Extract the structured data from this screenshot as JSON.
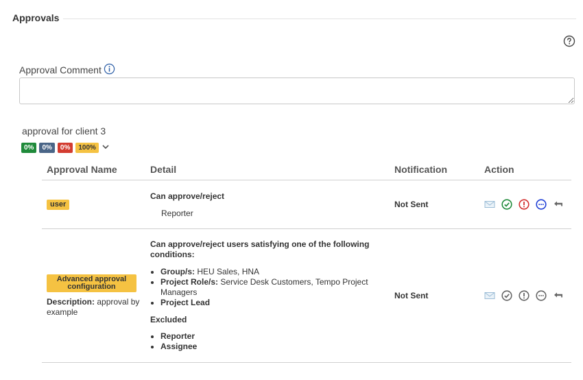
{
  "section": {
    "title": "Approvals"
  },
  "help": {
    "icon": "help-circle-icon"
  },
  "comment": {
    "label": "Approval Comment",
    "value": "",
    "placeholder": "",
    "info_icon": "info-icon"
  },
  "approval": {
    "title": "approval for client 3",
    "badges": [
      {
        "label": "0%",
        "color": "#1f8a3a"
      },
      {
        "label": "0%",
        "color": "#4a6587"
      },
      {
        "label": "0%",
        "color": "#d33c30"
      },
      {
        "label": "100%",
        "color": "#f5c242"
      }
    ],
    "expand_icon": "chevron-down-icon"
  },
  "table": {
    "headers": {
      "name": "Approval Name",
      "detail": "Detail",
      "notification": "Notification",
      "action": "Action"
    },
    "rows": [
      {
        "name": "user",
        "detail_title": "Can approve/reject",
        "detail_sub": "Reporter",
        "notification": "Not Sent",
        "actions": [
          "envelope-icon",
          "approve-check-icon",
          "reject-exclamation-icon",
          "more-options-icon",
          "return-arrow-icon"
        ]
      },
      {
        "name": "Advanced approval configuration",
        "description_label": "Description:",
        "description_value": " approval by example",
        "detail_title": "Can approve/reject users satisfying one of the following conditions:",
        "conditions": {
          "groups_label": "Group/s:",
          "groups_value": " HEU Sales, HNA",
          "roles_label": "Project Role/s:",
          "roles_value": " Service Desk Customers, Tempo Project Managers",
          "lead": "Project Lead"
        },
        "excluded_label": "Excluded",
        "excluded": [
          "Reporter",
          "Assignee"
        ],
        "notification": "Not Sent",
        "actions": [
          "envelope-icon",
          "approve-check-icon",
          "reject-exclamation-icon",
          "more-options-icon",
          "return-arrow-icon"
        ]
      }
    ]
  },
  "colors": {
    "approve_active": "#1f8a3a",
    "reject_active": "#d32f2f",
    "more_active": "#1f3fd6",
    "inactive": "#666666",
    "envelope": "#9bbcd6",
    "badge_yellow": "#f5c242"
  }
}
